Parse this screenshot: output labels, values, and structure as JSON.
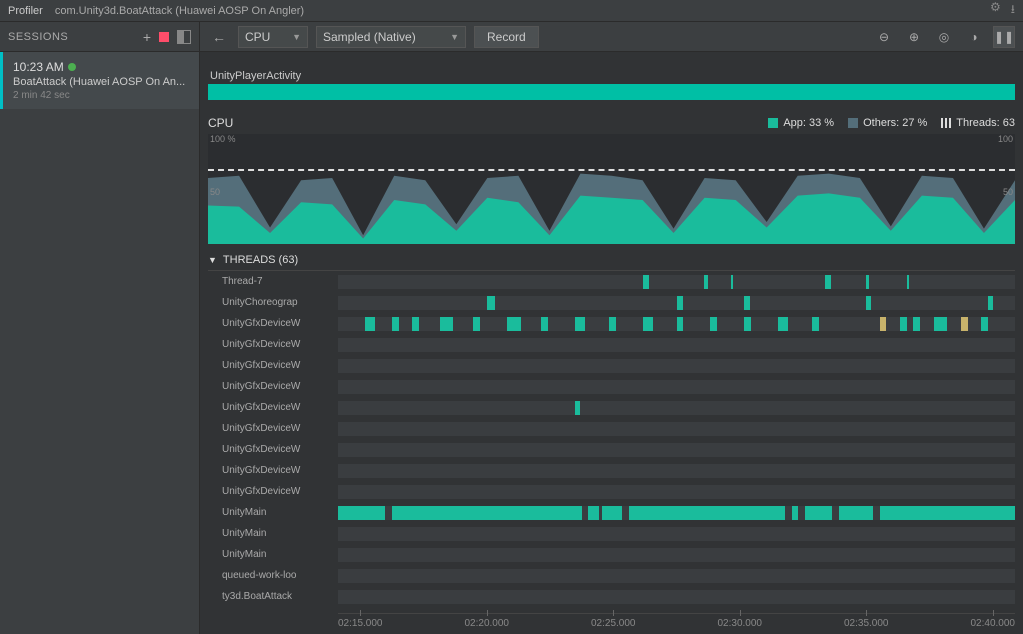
{
  "titlebar": {
    "tab1": "Profiler",
    "tab2": "com.Unity3d.BoatAttack (Huawei AOSP On Angler)"
  },
  "sidebar": {
    "title": "SESSIONS",
    "session": {
      "time": "10:23 AM",
      "name": "BoatAttack (Huawei AOSP On An...",
      "duration": "2 min 42 sec"
    }
  },
  "toolbar": {
    "dd1": "CPU",
    "dd2": "Sampled (Native)",
    "record": "Record"
  },
  "activity": {
    "label": "UnityPlayerActivity"
  },
  "cpu": {
    "title": "CPU",
    "axis_top": "100 %",
    "axis_mid": "50",
    "axis_top_r": "100",
    "axis_mid_r": "50",
    "legend": {
      "app": "App: 33 %",
      "others": "Others: 27 %",
      "threads": "Threads: 63"
    }
  },
  "chart_data": {
    "type": "area",
    "title": "CPU",
    "ylabel": "%",
    "ylim": [
      0,
      100
    ],
    "x": [
      "02:15.000",
      "02:20.000",
      "02:25.000",
      "02:30.000",
      "02:35.000",
      "02:40.000"
    ],
    "series": [
      {
        "name": "App",
        "values": [
          35,
          34,
          10,
          38,
          36,
          5,
          40,
          36,
          12,
          42,
          38,
          8,
          44,
          42,
          40,
          10,
          42,
          40,
          15,
          44,
          46,
          42,
          12,
          44,
          42,
          10,
          40
        ]
      },
      {
        "name": "Others",
        "values": [
          60,
          62,
          15,
          58,
          60,
          8,
          62,
          58,
          18,
          60,
          62,
          12,
          64,
          62,
          58,
          14,
          60,
          58,
          20,
          62,
          64,
          60,
          16,
          62,
          60,
          14,
          58
        ]
      }
    ],
    "threads_line": 63
  },
  "threads": {
    "header": "THREADS (63)",
    "rows": [
      {
        "name": "Thread-7",
        "segs": [
          [
            45,
            1
          ],
          [
            54,
            0.6
          ],
          [
            58,
            0.3
          ],
          [
            72,
            0.8
          ],
          [
            78,
            0.5
          ],
          [
            84,
            0.4
          ]
        ]
      },
      {
        "name": "UnityChoreograp",
        "segs": [
          [
            22,
            1.2
          ],
          [
            50,
            1
          ],
          [
            60,
            0.8
          ],
          [
            78,
            0.8
          ],
          [
            96,
            0.8
          ]
        ]
      },
      {
        "name": "UnityGfxDeviceW",
        "segs": [
          [
            4,
            1.5
          ],
          [
            8,
            1
          ],
          [
            11,
            1
          ],
          [
            15,
            2
          ],
          [
            20,
            1
          ],
          [
            25,
            2
          ],
          [
            30,
            1
          ],
          [
            35,
            1.5
          ],
          [
            40,
            1
          ],
          [
            45,
            1.5
          ],
          [
            50,
            1
          ],
          [
            55,
            1
          ],
          [
            60,
            1
          ],
          [
            65,
            1.5
          ],
          [
            70,
            1
          ],
          [
            80,
            1,
            "y"
          ],
          [
            83,
            1
          ],
          [
            85,
            1
          ],
          [
            88,
            2
          ],
          [
            92,
            1,
            "y"
          ],
          [
            95,
            1
          ]
        ]
      },
      {
        "name": "UnityGfxDeviceW",
        "segs": []
      },
      {
        "name": "UnityGfxDeviceW",
        "segs": []
      },
      {
        "name": "UnityGfxDeviceW",
        "segs": []
      },
      {
        "name": "UnityGfxDeviceW",
        "segs": [
          [
            35,
            0.8
          ]
        ]
      },
      {
        "name": "UnityGfxDeviceW",
        "segs": []
      },
      {
        "name": "UnityGfxDeviceW",
        "segs": []
      },
      {
        "name": "UnityGfxDeviceW",
        "segs": []
      },
      {
        "name": "UnityGfxDeviceW",
        "segs": []
      },
      {
        "name": "UnityMain",
        "segs": [
          [
            0,
            7
          ],
          [
            8,
            28
          ],
          [
            37,
            1.5
          ],
          [
            39,
            3
          ],
          [
            43,
            23
          ],
          [
            67,
            1
          ],
          [
            69,
            4
          ],
          [
            74,
            5
          ],
          [
            80,
            20
          ]
        ]
      },
      {
        "name": "UnityMain",
        "segs": []
      },
      {
        "name": "UnityMain",
        "segs": []
      },
      {
        "name": "queued-work-loo",
        "segs": []
      },
      {
        "name": "ty3d.BoatAttack",
        "segs": []
      }
    ]
  },
  "timeline": [
    "02:15.000",
    "02:20.000",
    "02:25.000",
    "02:30.000",
    "02:35.000",
    "02:40.000"
  ]
}
